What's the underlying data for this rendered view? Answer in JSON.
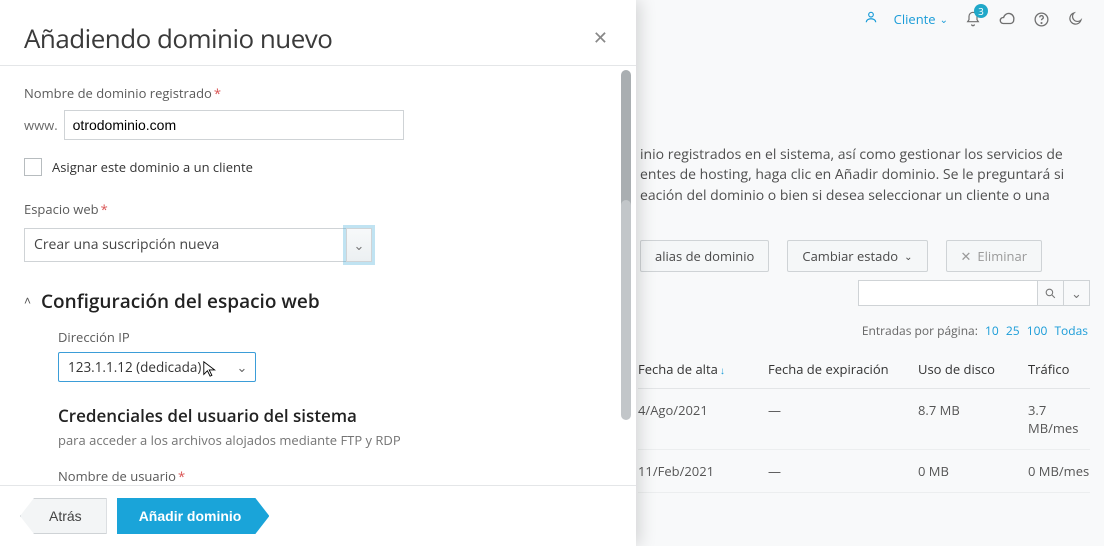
{
  "topbar": {
    "client_label": "Cliente",
    "notification_count": "3"
  },
  "bg": {
    "description_line1": "inio registrados en el sistema, así como gestionar los servicios de",
    "description_line2": "entes de hosting, haga clic en Añadir dominio. Se le preguntará si",
    "description_line3": "eación del dominio o bien si desea seleccionar un cliente o una",
    "btn_alias": "alias de dominio",
    "btn_state": "Cambiar estado",
    "btn_delete": "Eliminar",
    "pager_label": "Entradas por página:",
    "pager_10": "10",
    "pager_25": "25",
    "pager_100": "100",
    "pager_all": "Todas",
    "col_alt": "Fecha de alta",
    "col_exp": "Fecha de expiración",
    "col_disk": "Uso de disco",
    "col_traf": "Tráfico",
    "rows": [
      {
        "alt": "4/Ago/2021",
        "exp": "—",
        "disk": "8.7 MB",
        "traf": "3.7 MB/mes"
      },
      {
        "alt": "11/Feb/2021",
        "exp": "—",
        "disk": "0 MB",
        "traf": "0 MB/mes"
      }
    ]
  },
  "modal": {
    "title": "Añadiendo dominio nuevo",
    "domain_label": "Nombre de dominio registrado",
    "www_prefix": "www.",
    "domain_value": "otrodominio.com",
    "assign_label": "Asignar este dominio a un cliente",
    "webspace_label": "Espacio web",
    "webspace_value": "Crear una suscripción nueva",
    "section_title": "Configuración del espacio web",
    "ip_label": "Dirección IP",
    "ip_value": "123.1.1.12 (dedicada)",
    "cred_title": "Credenciales del usuario del sistema",
    "cred_sub": "para acceder a los archivos alojados mediante FTP y RDP",
    "cred_user_label": "Nombre de usuario",
    "btn_back": "Atrás",
    "btn_add": "Añadir dominio"
  }
}
